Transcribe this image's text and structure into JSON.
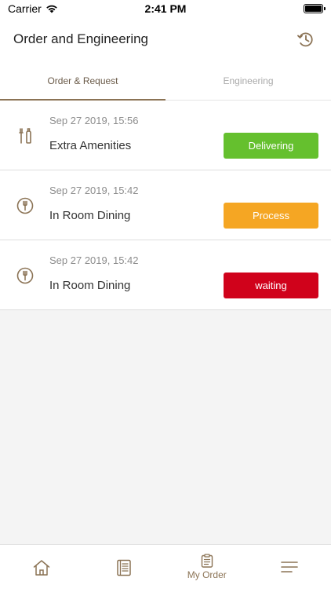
{
  "status_bar": {
    "carrier": "Carrier",
    "time": "2:41 PM",
    "wifi_icon": "wifi-icon",
    "battery_icon": "battery-icon"
  },
  "header": {
    "title": "Order and Engineering",
    "history_icon": "clock-history-icon"
  },
  "tabs": [
    {
      "label": "Order & Request",
      "active": true
    },
    {
      "label": "Engineering",
      "active": false
    }
  ],
  "orders": [
    {
      "date": "Sep 27 2019, 15:56",
      "name": "Extra Amenities",
      "status": "Delivering",
      "status_color": "#65c02e",
      "icon": "toiletries-icon"
    },
    {
      "date": "Sep 27 2019, 15:42",
      "name": "In Room Dining",
      "status": "Process",
      "status_color": "#f5a623",
      "icon": "dining-icon"
    },
    {
      "date": "Sep 27 2019, 15:42",
      "name": "In Room Dining",
      "status": "waiting",
      "status_color": "#d0021b",
      "icon": "dining-icon"
    }
  ],
  "tab_bar": [
    {
      "icon": "home-icon",
      "label": "",
      "active": false
    },
    {
      "icon": "menu-book-icon",
      "label": "",
      "active": false
    },
    {
      "icon": "clipboard-icon",
      "label": "My Order",
      "active": true
    },
    {
      "icon": "hamburger-menu-icon",
      "label": "",
      "active": false
    }
  ],
  "colors": {
    "accent": "#8b7355",
    "delivering": "#65c02e",
    "process": "#f5a623",
    "waiting": "#d0021b"
  }
}
